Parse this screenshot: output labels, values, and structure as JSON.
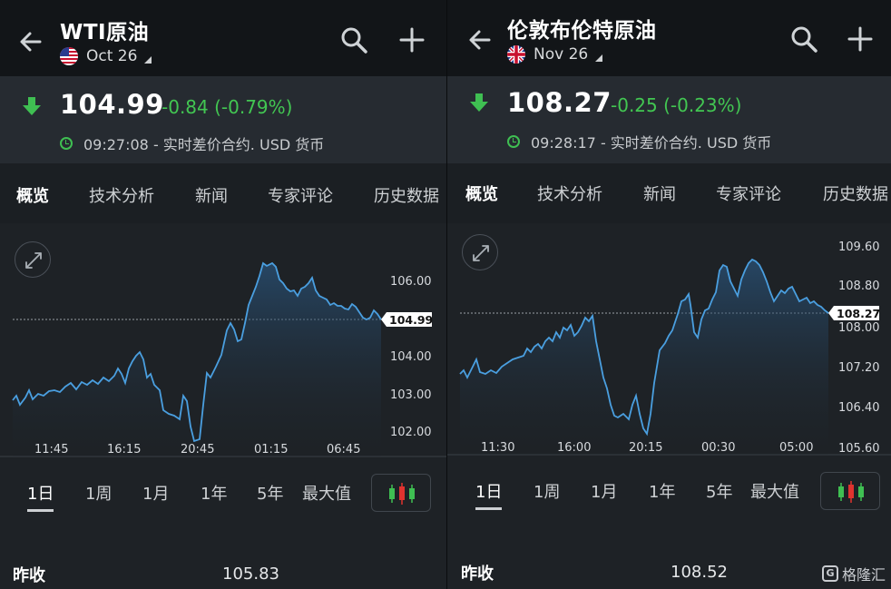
{
  "panels": [
    {
      "title": "WTI原油",
      "expiry": "Oct 26",
      "flag": "us",
      "price": "104.99",
      "change": "-0.84 (-0.79%)",
      "time_info": "09:27:08 - 实时差价合约. USD 货币",
      "tabs": [
        "概览",
        "技术分析",
        "新闻",
        "专家评论",
        "历史数据"
      ],
      "timeframes": [
        "1日",
        "1周",
        "1月",
        "1年",
        "5年",
        "最大值"
      ],
      "prev_close_label": "昨收",
      "prev_close_value": "105.83",
      "chart": {
        "y_ticks": [
          "106.00",
          "104.00",
          "103.00",
          "102.00"
        ],
        "x_ticks": [
          "11:45",
          "16:15",
          "20:45",
          "01:15",
          "06:45"
        ],
        "current_label": "104.99"
      }
    },
    {
      "title": "伦敦布伦特原油",
      "expiry": "Nov 26",
      "flag": "uk",
      "price": "108.27",
      "change": "-0.25 (-0.23%)",
      "time_info": "09:28:17 - 实时差价合约. USD 货币",
      "tabs": [
        "概览",
        "技术分析",
        "新闻",
        "专家评论",
        "历史数据"
      ],
      "timeframes": [
        "1日",
        "1周",
        "1月",
        "1年",
        "5年",
        "最大值"
      ],
      "prev_close_label": "昨收",
      "prev_close_value": "108.52",
      "chart": {
        "y_ticks": [
          "109.60",
          "108.80",
          "108.00",
          "107.20",
          "106.40",
          "105.60"
        ],
        "x_ticks": [
          "11:30",
          "16:00",
          "20:15",
          "00:30",
          "05:00"
        ],
        "current_label": "108.27"
      }
    }
  ],
  "watermark": "格隆汇",
  "colors": {
    "down": "#42c652",
    "line": "#4a9fe0",
    "bg": "#1e2226"
  }
}
